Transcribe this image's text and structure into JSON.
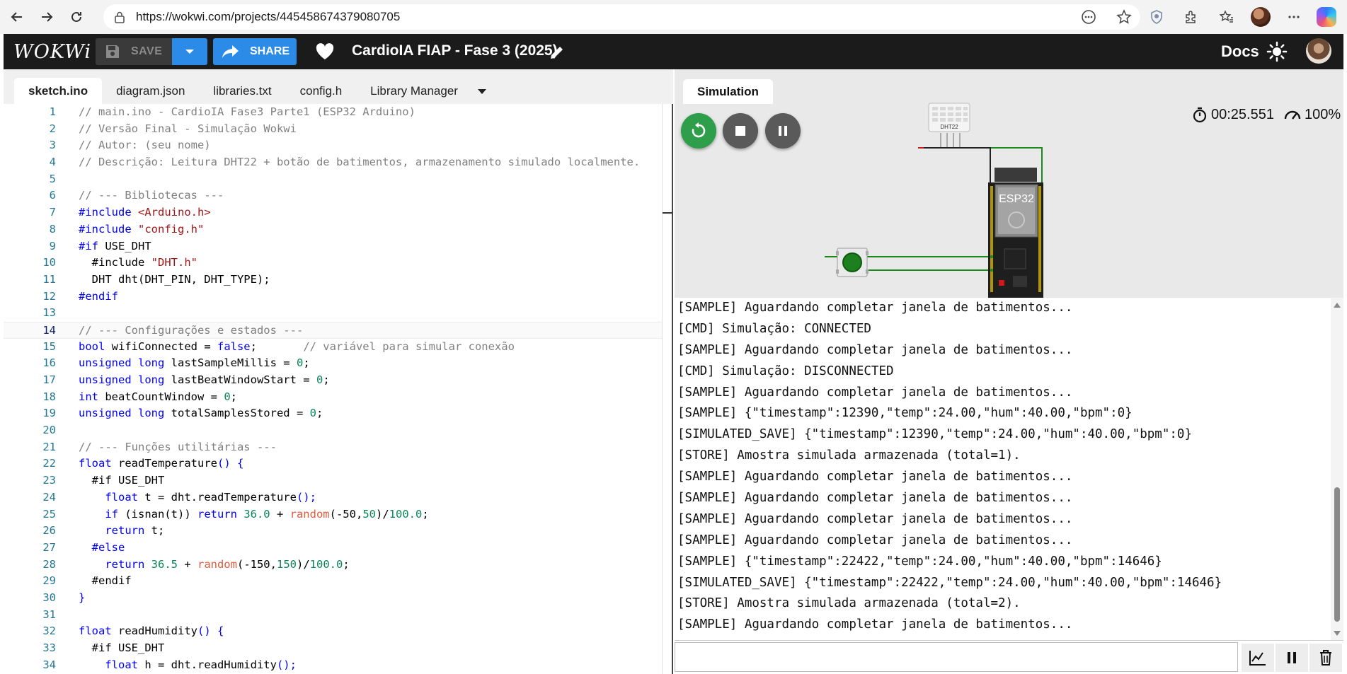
{
  "browser": {
    "url": "https://wokwi.com/projects/445458674379080705"
  },
  "header": {
    "logo": "WOKWi",
    "save_label": "SAVE",
    "share_label": "SHARE",
    "project_title": "CardioIA FIAP - Fase 3 (2025)",
    "docs_label": "Docs"
  },
  "editor": {
    "tabs": [
      "sketch.ino",
      "diagram.json",
      "libraries.txt",
      "config.h",
      "Library Manager"
    ],
    "active_tab": "sketch.ino",
    "current_line": 14,
    "lines": [
      [
        {
          "t": "// main.ino - CardioIA Fase3 Parte1 (ESP32 Arduino)",
          "c": "#808080"
        }
      ],
      [
        {
          "t": "// Versão Final - Simulação Wokwi",
          "c": "#808080"
        }
      ],
      [
        {
          "t": "// Autor: (seu nome)",
          "c": "#808080"
        }
      ],
      [
        {
          "t": "// Descrição: Leitura DHT22 + botão de batimentos, armazenamento simulado localmente.",
          "c": "#808080"
        }
      ],
      [],
      [
        {
          "t": "// --- Bibliotecas ---",
          "c": "#808080"
        }
      ],
      [
        {
          "t": "#include ",
          "c": "#0000ff"
        },
        {
          "t": "<Arduino.h>",
          "c": "#a31515"
        }
      ],
      [
        {
          "t": "#include ",
          "c": "#0000ff"
        },
        {
          "t": "\"config.h\"",
          "c": "#a31515"
        }
      ],
      [
        {
          "t": "#if ",
          "c": "#0000ff"
        },
        {
          "t": "USE_DHT",
          "c": "#000000"
        }
      ],
      [
        {
          "t": "  #include ",
          "c": "#000000"
        },
        {
          "t": "\"DHT.h\"",
          "c": "#a31515"
        }
      ],
      [
        {
          "t": "  DHT dht(DHT_PIN, DHT_TYPE);",
          "c": "#000000"
        }
      ],
      [
        {
          "t": "#endif",
          "c": "#0000ff"
        }
      ],
      [],
      [
        {
          "t": "// --- Configurações e estados ---",
          "c": "#808080"
        }
      ],
      [
        {
          "t": "bool ",
          "c": "#0000ff"
        },
        {
          "t": "wifiConnected = ",
          "c": "#000000"
        },
        {
          "t": "false",
          "c": "#0000ff"
        },
        {
          "t": ";       ",
          "c": "#000000"
        },
        {
          "t": "// variável para simular conexão",
          "c": "#808080"
        }
      ],
      [
        {
          "t": "unsigned long ",
          "c": "#0000ff"
        },
        {
          "t": "lastSampleMillis = ",
          "c": "#000000"
        },
        {
          "t": "0",
          "c": "#098658"
        },
        {
          "t": ";",
          "c": "#000000"
        }
      ],
      [
        {
          "t": "unsigned long ",
          "c": "#0000ff"
        },
        {
          "t": "lastBeatWindowStart = ",
          "c": "#000000"
        },
        {
          "t": "0",
          "c": "#098658"
        },
        {
          "t": ";",
          "c": "#000000"
        }
      ],
      [
        {
          "t": "int ",
          "c": "#0000ff"
        },
        {
          "t": "beatCountWindow = ",
          "c": "#000000"
        },
        {
          "t": "0",
          "c": "#098658"
        },
        {
          "t": ";",
          "c": "#000000"
        }
      ],
      [
        {
          "t": "unsigned long ",
          "c": "#0000ff"
        },
        {
          "t": "totalSamplesStored = ",
          "c": "#000000"
        },
        {
          "t": "0",
          "c": "#098658"
        },
        {
          "t": ";",
          "c": "#000000"
        }
      ],
      [],
      [
        {
          "t": "// --- Funções utilitárias ---",
          "c": "#808080"
        }
      ],
      [
        {
          "t": "float ",
          "c": "#0000ff"
        },
        {
          "t": "readTemperature",
          "c": "#000000"
        },
        {
          "t": "() {",
          "c": "#0000ff"
        }
      ],
      [
        {
          "t": "  #if ",
          "c": "#000000"
        },
        {
          "t": "USE_DHT",
          "c": "#000000"
        }
      ],
      [
        {
          "t": "    float ",
          "c": "#0000ff"
        },
        {
          "t": "t = dht.readTemperature",
          "c": "#000000"
        },
        {
          "t": "();",
          "c": "#0000ff"
        }
      ],
      [
        {
          "t": "    if ",
          "c": "#0000ff"
        },
        {
          "t": "(isnan(t)) ",
          "c": "#000000"
        },
        {
          "t": "return ",
          "c": "#0000ff"
        },
        {
          "t": "36.0",
          "c": "#098658"
        },
        {
          "t": " + ",
          "c": "#000000"
        },
        {
          "t": "random",
          "c": "#e05a3a"
        },
        {
          "t": "(-50,",
          "c": "#000000"
        },
        {
          "t": "50",
          "c": "#098658"
        },
        {
          "t": ")/",
          "c": "#000000"
        },
        {
          "t": "100.0",
          "c": "#098658"
        },
        {
          "t": ";",
          "c": "#000000"
        }
      ],
      [
        {
          "t": "    return ",
          "c": "#0000ff"
        },
        {
          "t": "t;",
          "c": "#000000"
        }
      ],
      [
        {
          "t": "  #else",
          "c": "#0000ff"
        }
      ],
      [
        {
          "t": "    return ",
          "c": "#0000ff"
        },
        {
          "t": "36.5",
          "c": "#098658"
        },
        {
          "t": " + ",
          "c": "#000000"
        },
        {
          "t": "random",
          "c": "#e05a3a"
        },
        {
          "t": "(-150,",
          "c": "#000000"
        },
        {
          "t": "150",
          "c": "#098658"
        },
        {
          "t": ")/",
          "c": "#000000"
        },
        {
          "t": "100.0",
          "c": "#098658"
        },
        {
          "t": ";",
          "c": "#000000"
        }
      ],
      [
        {
          "t": "  #endif",
          "c": "#000000"
        }
      ],
      [
        {
          "t": "}",
          "c": "#0000ff"
        }
      ],
      [],
      [
        {
          "t": "float ",
          "c": "#0000ff"
        },
        {
          "t": "readHumidity",
          "c": "#000000"
        },
        {
          "t": "() {",
          "c": "#0000ff"
        }
      ],
      [
        {
          "t": "  #if ",
          "c": "#000000"
        },
        {
          "t": "USE_DHT",
          "c": "#000000"
        }
      ],
      [
        {
          "t": "    float ",
          "c": "#0000ff"
        },
        {
          "t": "h = dht.readHumidity",
          "c": "#000000"
        },
        {
          "t": "();",
          "c": "#0000ff"
        }
      ]
    ]
  },
  "simulation": {
    "tab_label": "Simulation",
    "timer": "00:25.551",
    "speed": "100%",
    "dht_label": "DHT22",
    "esp_label": "ESP32"
  },
  "serial": {
    "lines": [
      "[SAMPLE] Aguardando completar janela de batimentos...",
      "[CMD] Simulação: CONNECTED",
      "[SAMPLE] Aguardando completar janela de batimentos...",
      "[CMD] Simulação: DISCONNECTED",
      "[SAMPLE] Aguardando completar janela de batimentos...",
      "[SAMPLE] {\"timestamp\":12390,\"temp\":24.00,\"hum\":40.00,\"bpm\":0}",
      "[SIMULATED_SAVE] {\"timestamp\":12390,\"temp\":24.00,\"hum\":40.00,\"bpm\":0}",
      "[STORE] Amostra simulada armazenada (total=1).",
      "[SAMPLE] Aguardando completar janela de batimentos...",
      "[SAMPLE] Aguardando completar janela de batimentos...",
      "[SAMPLE] Aguardando completar janela de batimentos...",
      "[SAMPLE] Aguardando completar janela de batimentos...",
      "[SAMPLE] {\"timestamp\":22422,\"temp\":24.00,\"hum\":40.00,\"bpm\":14646}",
      "[SIMULATED_SAVE] {\"timestamp\":22422,\"temp\":24.00,\"hum\":40.00,\"bpm\":14646}",
      "[STORE] Amostra simulada armazenada (total=2).",
      "[SAMPLE] Aguardando completar janela de batimentos..."
    ],
    "input_value": ""
  }
}
